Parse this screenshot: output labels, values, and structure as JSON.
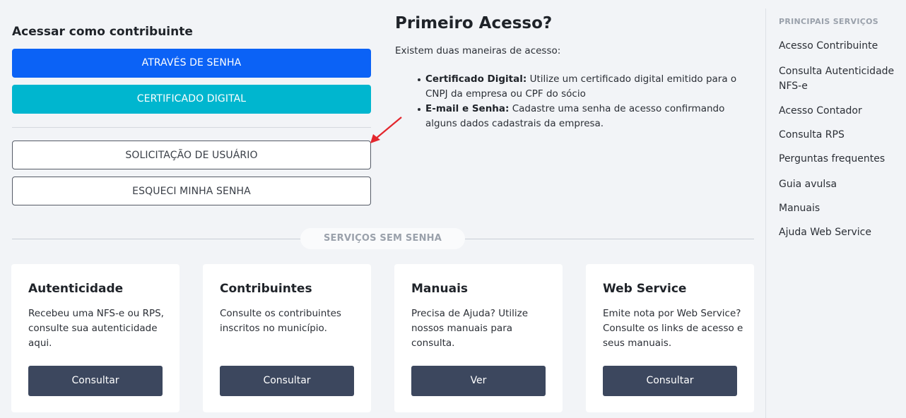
{
  "login": {
    "title": "Acessar como contribuinte",
    "btn_senha": "ATRAVÉS DE SENHA",
    "btn_certificado": "CERTIFICADO DIGITAL",
    "btn_solicitacao": "SOLICITAÇÃO DE USUÁRIO",
    "btn_esqueci": "ESQUECI MINHA SENHA"
  },
  "primeiro_acesso": {
    "title": "Primeiro Acesso?",
    "intro": "Existem duas maneiras de acesso:",
    "items": [
      {
        "label": "Certificado Digital:",
        "text": " Utilize um certificado digital emitido para o CNPJ da empresa ou CPF do sócio"
      },
      {
        "label": "E-mail e Senha:",
        "text": " Cadastre uma senha de acesso confirmando alguns dados cadastrais da empresa."
      }
    ]
  },
  "servicos": {
    "separator_label": "SERVIÇOS SEM SENHA",
    "cards": [
      {
        "title": "Autenticidade",
        "desc": "Recebeu uma NFS-e ou RPS, consulte sua autenticidade aqui.",
        "button": "Consultar"
      },
      {
        "title": "Contribuintes",
        "desc": "Consulte os contribuintes inscritos no município.",
        "button": "Consultar"
      },
      {
        "title": "Manuais",
        "desc": "Precisa de Ajuda? Utilize nossos manuais para consulta.",
        "button": "Ver"
      },
      {
        "title": "Web Service",
        "desc": "Emite nota por Web Service? Consulte os links de acesso e seus manuais.",
        "button": "Consultar"
      }
    ]
  },
  "sidebar": {
    "title": "PRINCIPAIS SERVIÇOS",
    "items": [
      {
        "label": "Acesso Contribuinte"
      },
      {
        "label": "Consulta Autenticidade NFS-e"
      },
      {
        "label": "Acesso Contador"
      },
      {
        "label": "Consulta RPS"
      },
      {
        "label": "Perguntas frequentes"
      },
      {
        "label": "Guia avulsa"
      },
      {
        "label": "Manuais"
      },
      {
        "label": "Ajuda Web Service"
      }
    ]
  },
  "colors": {
    "primary_blue": "#0b62f6",
    "cyan": "#00b6cf",
    "dark_button": "#3c475e",
    "annotation_arrow": "#e3262d"
  },
  "icons": {
    "annotation": "red-arrow-icon"
  }
}
